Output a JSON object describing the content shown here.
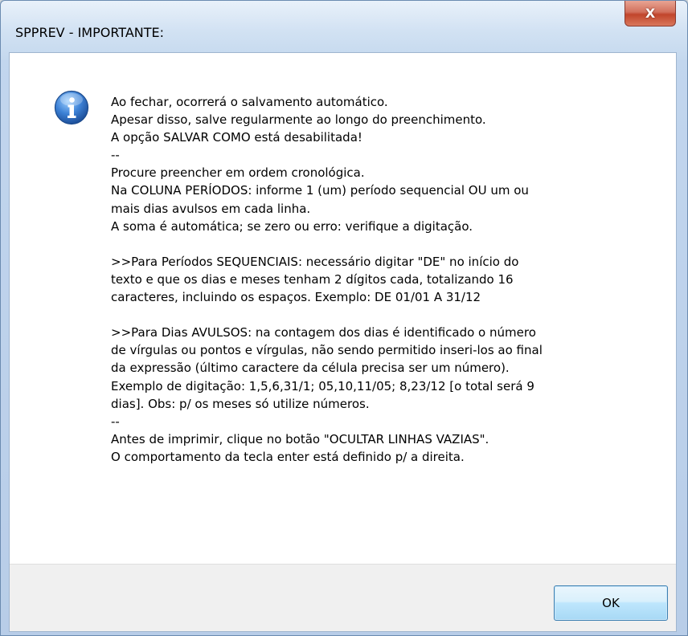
{
  "window": {
    "title": "SPPREV - IMPORTANTE:",
    "close_label": "X"
  },
  "icon": {
    "name": "info-icon",
    "color": "#2f6fc0"
  },
  "message": {
    "lines": [
      "Ao fechar, ocorrerá o salvamento automático.",
      "Apesar disso, salve regularmente ao longo do preenchimento.",
      "A opção SALVAR COMO está desabilitada!",
      "--",
      "Procure preencher em ordem cronológica.",
      "Na COLUNA PERÍODOS: informe 1 (um) período sequencial OU um ou",
      "mais dias avulsos em cada linha.",
      "A soma é automática; se zero ou erro: verifique a digitação.",
      "",
      ">>Para Períodos SEQUENCIAIS: necessário digitar \"DE\" no início do",
      "texto e que os dias e meses tenham 2 dígitos cada, totalizando 16",
      "caracteres, incluindo os espaços. Exemplo: DE 01/01 A 31/12",
      "",
      ">>Para Dias AVULSOS: na contagem dos dias é identificado o número",
      "de vírgulas ou pontos e vírgulas, não sendo permitido inseri-los ao final",
      "da expressão (último caractere da célula precisa ser um número).",
      "Exemplo de digitação: 1,5,6,31/1; 05,10,11/05; 8,23/12 [o total será 9",
      "dias]. Obs: p/ os meses só utilize números.",
      "--",
      "Antes de imprimir, clique no botão \"OCULTAR LINHAS VAZIAS\".",
      "O comportamento da tecla enter está definido p/ a direita."
    ]
  },
  "footer": {
    "ok_label": "OK"
  }
}
